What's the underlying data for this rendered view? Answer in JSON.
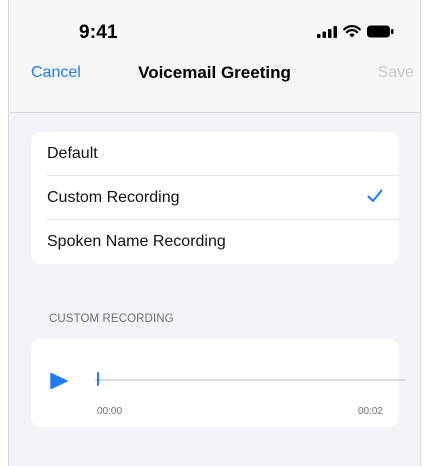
{
  "status_bar": {
    "time": "9:41",
    "icons": [
      "cellular-signal-icon",
      "wifi-icon",
      "battery-icon"
    ]
  },
  "nav": {
    "cancel_label": "Cancel",
    "title": "Voicemail Greeting",
    "save_label": "Save"
  },
  "greeting_options": {
    "items": [
      {
        "label": "Default",
        "selected": false
      },
      {
        "label": "Custom Recording",
        "selected": true
      },
      {
        "label": "Spoken Name Recording",
        "selected": false
      }
    ]
  },
  "recording": {
    "section_header": "CUSTOM RECORDING",
    "current_time": "00:00",
    "duration": "00:02",
    "progress": 0
  },
  "colors": {
    "accent": "#1d7cf2",
    "disabled": "#c7c7cc",
    "background": "#f2f2f7",
    "secondary_text": "#6d6d72"
  }
}
